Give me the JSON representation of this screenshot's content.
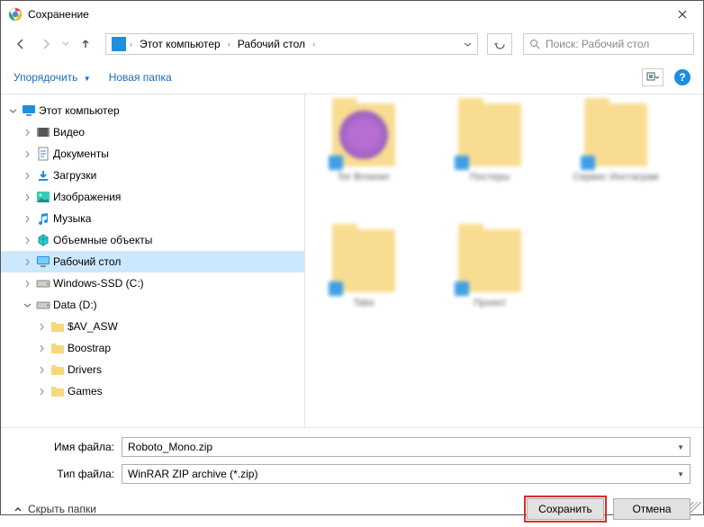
{
  "title": "Сохранение",
  "breadcrumbs": {
    "root": "Этот компьютер",
    "sub": "Рабочий стол"
  },
  "search_placeholder": "Поиск: Рабочий стол",
  "toolbar": {
    "organize": "Упорядочить",
    "newfolder": "Новая папка"
  },
  "tree": [
    {
      "depth": 0,
      "tw": "v",
      "icon": "pc",
      "label": "Этот компьютер",
      "sel": false
    },
    {
      "depth": 1,
      "tw": ">",
      "icon": "video",
      "label": "Видео",
      "sel": false
    },
    {
      "depth": 1,
      "tw": ">",
      "icon": "doc",
      "label": "Документы",
      "sel": false
    },
    {
      "depth": 1,
      "tw": ">",
      "icon": "down",
      "label": "Загрузки",
      "sel": false
    },
    {
      "depth": 1,
      "tw": ">",
      "icon": "img",
      "label": "Изображения",
      "sel": false
    },
    {
      "depth": 1,
      "tw": ">",
      "icon": "music",
      "label": "Музыка",
      "sel": false
    },
    {
      "depth": 1,
      "tw": ">",
      "icon": "obj",
      "label": "Объемные объекты",
      "sel": false
    },
    {
      "depth": 1,
      "tw": ">",
      "icon": "desk",
      "label": "Рабочий стол",
      "sel": true
    },
    {
      "depth": 1,
      "tw": ">",
      "icon": "drive",
      "label": "Windows-SSD (C:)",
      "sel": false
    },
    {
      "depth": 1,
      "tw": "v",
      "icon": "drive",
      "label": "Data (D:)",
      "sel": false
    },
    {
      "depth": 2,
      "tw": ">",
      "icon": "folder",
      "label": "$AV_ASW",
      "sel": false
    },
    {
      "depth": 2,
      "tw": ">",
      "icon": "folder",
      "label": "Boostrap",
      "sel": false
    },
    {
      "depth": 2,
      "tw": ">",
      "icon": "folder",
      "label": "Drivers",
      "sel": false
    },
    {
      "depth": 2,
      "tw": ">",
      "icon": "folder",
      "label": "Games",
      "sel": false
    }
  ],
  "files": [
    {
      "label": "Tor Browser",
      "variant": "tor"
    },
    {
      "label": "Постеры"
    },
    {
      "label": "Сервис Инстаграм"
    },
    {
      "label": "Tabs"
    },
    {
      "label": "Проект"
    }
  ],
  "form": {
    "name_label": "Имя файла:",
    "name_value": "Roboto_Mono.zip",
    "type_label": "Тип файла:",
    "type_value": "WinRAR ZIP archive (*.zip)"
  },
  "hide_folders": "Скрыть папки",
  "save": "Сохранить",
  "cancel": "Отмена"
}
